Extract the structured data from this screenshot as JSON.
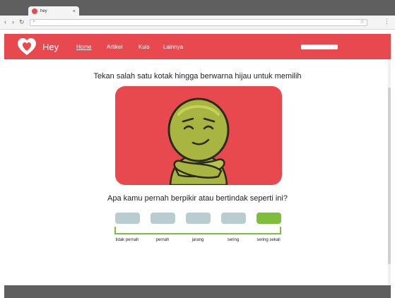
{
  "browser": {
    "tab_title": "hey",
    "tab_close": "×",
    "nav_back": "‹",
    "nav_forward": "›",
    "nav_reload": "↻",
    "omnibox_search_glyph": "⌕",
    "omnibox_star_glyph": "☆",
    "menu_glyph": "⋮"
  },
  "header": {
    "brand": "Hey",
    "nav": [
      {
        "label": "Home",
        "active": true
      },
      {
        "label": "Artikel",
        "active": false
      },
      {
        "label": "Kuis",
        "active": false
      },
      {
        "label": "Lainnya",
        "active": false
      }
    ],
    "search_glyph": "⌕"
  },
  "main": {
    "instruction": "Tekan salah satu kotak hingga berwarna hijau untuk memilih",
    "question": "Apa kamu pernah berpikir atau bertindak seperti ini?",
    "options": [
      {
        "label": "tidak pernah",
        "selected": false
      },
      {
        "label": "pernah",
        "selected": false
      },
      {
        "label": "jarang",
        "selected": false
      },
      {
        "label": "sering",
        "selected": false
      },
      {
        "label": "sering sekali",
        "selected": true
      }
    ]
  },
  "colors": {
    "brand_red": "#e8494f",
    "option_default": "#b9cdd0",
    "option_selected": "#7cbf3a",
    "character_green": "#a8b540"
  }
}
